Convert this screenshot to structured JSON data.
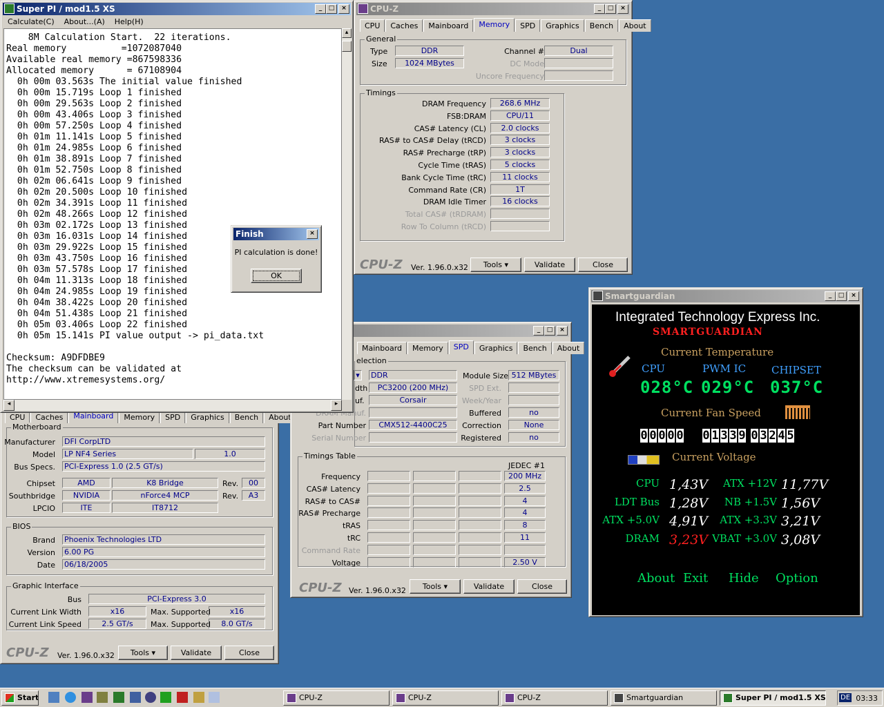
{
  "superpi": {
    "title": "Super PI / mod1.5 XS",
    "menu": [
      "Calculate(C)",
      "About...(A)",
      "Help(H)"
    ],
    "lines": [
      "    8M Calculation Start.  22 iterations.",
      "Real memory          =1072087040",
      "Available real memory =867598336",
      "Allocated memory      = 67108904",
      "  0h 00m 03.563s The initial value finished",
      "  0h 00m 15.719s Loop 1 finished",
      "  0h 00m 29.563s Loop 2 finished",
      "  0h 00m 43.406s Loop 3 finished",
      "  0h 00m 57.250s Loop 4 finished",
      "  0h 01m 11.141s Loop 5 finished",
      "  0h 01m 24.985s Loop 6 finished",
      "  0h 01m 38.891s Loop 7 finished",
      "  0h 01m 52.750s Loop 8 finished",
      "  0h 02m 06.641s Loop 9 finished",
      "  0h 02m 20.500s Loop 10 finished",
      "  0h 02m 34.391s Loop 11 finished",
      "  0h 02m 48.266s Loop 12 finished",
      "  0h 03m 02.172s Loop 13 finished",
      "  0h 03m 16.031s Loop 14 finished",
      "  0h 03m 29.922s Loop 15 finished",
      "  0h 03m 43.750s Loop 16 finished",
      "  0h 03m 57.578s Loop 17 finished",
      "  0h 04m 11.313s Loop 18 finished",
      "  0h 04m 24.985s Loop 19 finished",
      "  0h 04m 38.422s Loop 20 finished",
      "  0h 04m 51.438s Loop 21 finished",
      "  0h 05m 03.406s Loop 22 finished",
      "  0h 05m 15.141s PI value output -> pi_data.txt",
      "",
      "Checksum: A9DFDBE9",
      "The checksum can be validated at",
      "http://www.xtremesystems.org/"
    ]
  },
  "finish": {
    "title": "Finish",
    "message": "PI calculation is done!",
    "ok": "OK"
  },
  "cpuz_mem": {
    "title": "CPU-Z",
    "tabs": [
      "CPU",
      "Caches",
      "Mainboard",
      "Memory",
      "SPD",
      "Graphics",
      "Bench",
      "About"
    ],
    "general": "General",
    "type_label": "Type",
    "type": "DDR",
    "size_label": "Size",
    "size": "1024 MBytes",
    "channel_label": "Channel #",
    "channel": "Dual",
    "dc_label": "DC Mode",
    "uncore_label": "Uncore Frequency",
    "timings": "Timings",
    "rows": [
      [
        "DRAM Frequency",
        "268.6 MHz"
      ],
      [
        "FSB:DRAM",
        "CPU/11"
      ],
      [
        "CAS# Latency (CL)",
        "2.0 clocks"
      ],
      [
        "RAS# to CAS# Delay (tRCD)",
        "3 clocks"
      ],
      [
        "RAS# Precharge (tRP)",
        "3 clocks"
      ],
      [
        "Cycle Time (tRAS)",
        "5 clocks"
      ],
      [
        "Bank Cycle Time (tRC)",
        "11 clocks"
      ],
      [
        "Command Rate (CR)",
        "1T"
      ],
      [
        "DRAM Idle Timer",
        "16 clocks"
      ],
      [
        "Total CAS# (tRDRAM)",
        ""
      ],
      [
        "Row To Column (tRCD)",
        ""
      ]
    ],
    "logo": "CPU-Z",
    "version": "Ver. 1.96.0.x32",
    "tools": "Tools",
    "validate": "Validate",
    "close": "Close"
  },
  "cpuz_spd": {
    "tabs": [
      "Mainboard",
      "Memory",
      "SPD",
      "Graphics",
      "Bench",
      "About"
    ],
    "slot_title": "election",
    "type": "DDR",
    "module_size_label": "Module Size",
    "module_size": "512 MBytes",
    "width_l": "dth",
    "width": "PC3200 (200 MHz)",
    "spd_ext": "SPD Ext.",
    "manuf_l": "uf.",
    "manuf": "Corsair",
    "week": "Week/Year",
    "dram_manuf": "DRAM Manuf.",
    "buffered": "Buffered",
    "buffered_v": "no",
    "part_l": "Part Number",
    "part": "CMX512-4400C25",
    "correction": "Correction",
    "correction_v": "None",
    "serial_l": "Serial Number",
    "registered": "Registered",
    "registered_v": "no",
    "timings_table": "Timings Table",
    "jedec": "JEDEC #1",
    "trows": [
      [
        "Frequency",
        "200 MHz"
      ],
      [
        "CAS# Latency",
        "2.5"
      ],
      [
        "RAS# to CAS#",
        "4"
      ],
      [
        "RAS# Precharge",
        "4"
      ],
      [
        "tRAS",
        "8"
      ],
      [
        "tRC",
        "11"
      ],
      [
        "Command Rate",
        ""
      ],
      [
        "Voltage",
        "2.50 V"
      ]
    ]
  },
  "cpuz_mb": {
    "tabs": [
      "CPU",
      "Caches",
      "Mainboard",
      "Memory",
      "SPD",
      "Graphics",
      "Bench",
      "About"
    ],
    "motherboard": "Motherboard",
    "manufacturer_l": "Manufacturer",
    "manufacturer": "DFI CorpLTD",
    "model_l": "Model",
    "model": "LP NF4 Series",
    "model_rev": "1.0",
    "bus_l": "Bus Specs.",
    "bus": "PCI-Express 1.0 (2.5 GT/s)",
    "chipset_l": "Chipset",
    "chipset": "AMD",
    "chipset2": "K8 Bridge",
    "rev_l": "Rev.",
    "chipset_rev": "00",
    "south_l": "Southbridge",
    "south": "NVIDIA",
    "south2": "nForce4 MCP",
    "south_rev": "A3",
    "lpcio_l": "LPCIO",
    "lpcio": "ITE",
    "lpcio2": "IT8712",
    "bios": "BIOS",
    "brand_l": "Brand",
    "brand": "Phoenix Technologies LTD",
    "version_l": "Version",
    "version": "6.00 PG",
    "date_l": "Date",
    "date": "06/18/2005",
    "gi": "Graphic Interface",
    "gbus_l": "Bus",
    "gbus": "PCI-Express 3.0",
    "clw_l": "Current Link Width",
    "clw": "x16",
    "msup_l": "Max. Supported",
    "msw": "x16",
    "cls_l": "Current Link Speed",
    "cls": "2.5 GT/s",
    "mss": "8.0 GT/s"
  },
  "sg": {
    "title": "Smartguardian",
    "company": "Integrated Technology Express Inc.",
    "brand": "SMARTGUARDIAN",
    "temp_title": "Current Temperature",
    "t_cpu_l": "CPU",
    "t_pwm_l": "PWM IC",
    "t_chip_l": "CHIPSET",
    "t_cpu": "028°C",
    "t_pwm": "029°C",
    "t_chip": "037°C",
    "fan_title": "Current Fan Speed",
    "fan1": "00000",
    "fan2": "01339",
    "fan3": "03245",
    "volt_title": "Current Voltage",
    "v": [
      [
        "CPU",
        "1,43V",
        "ATX +12V",
        "11,77V"
      ],
      [
        "LDT Bus",
        "1,28V",
        "NB +1.5V",
        "1,56V"
      ],
      [
        "ATX +5.0V",
        "4,91V",
        "ATX +3.3V",
        "3,21V"
      ],
      [
        "DRAM",
        "3,23V",
        "VBAT +3.0V",
        "3,08V"
      ]
    ],
    "about": "About",
    "exit": "Exit",
    "hide": "Hide",
    "option": "Option",
    "accent": "#00e060",
    "warn": "#ff2020"
  },
  "taskbar": {
    "start": "Start",
    "tasks": [
      "CPU-Z",
      "CPU-Z",
      "CPU-Z",
      "Smartguardian",
      "Super PI / mod1.5 XS"
    ],
    "clock": "03:33",
    "lang": "DE"
  }
}
